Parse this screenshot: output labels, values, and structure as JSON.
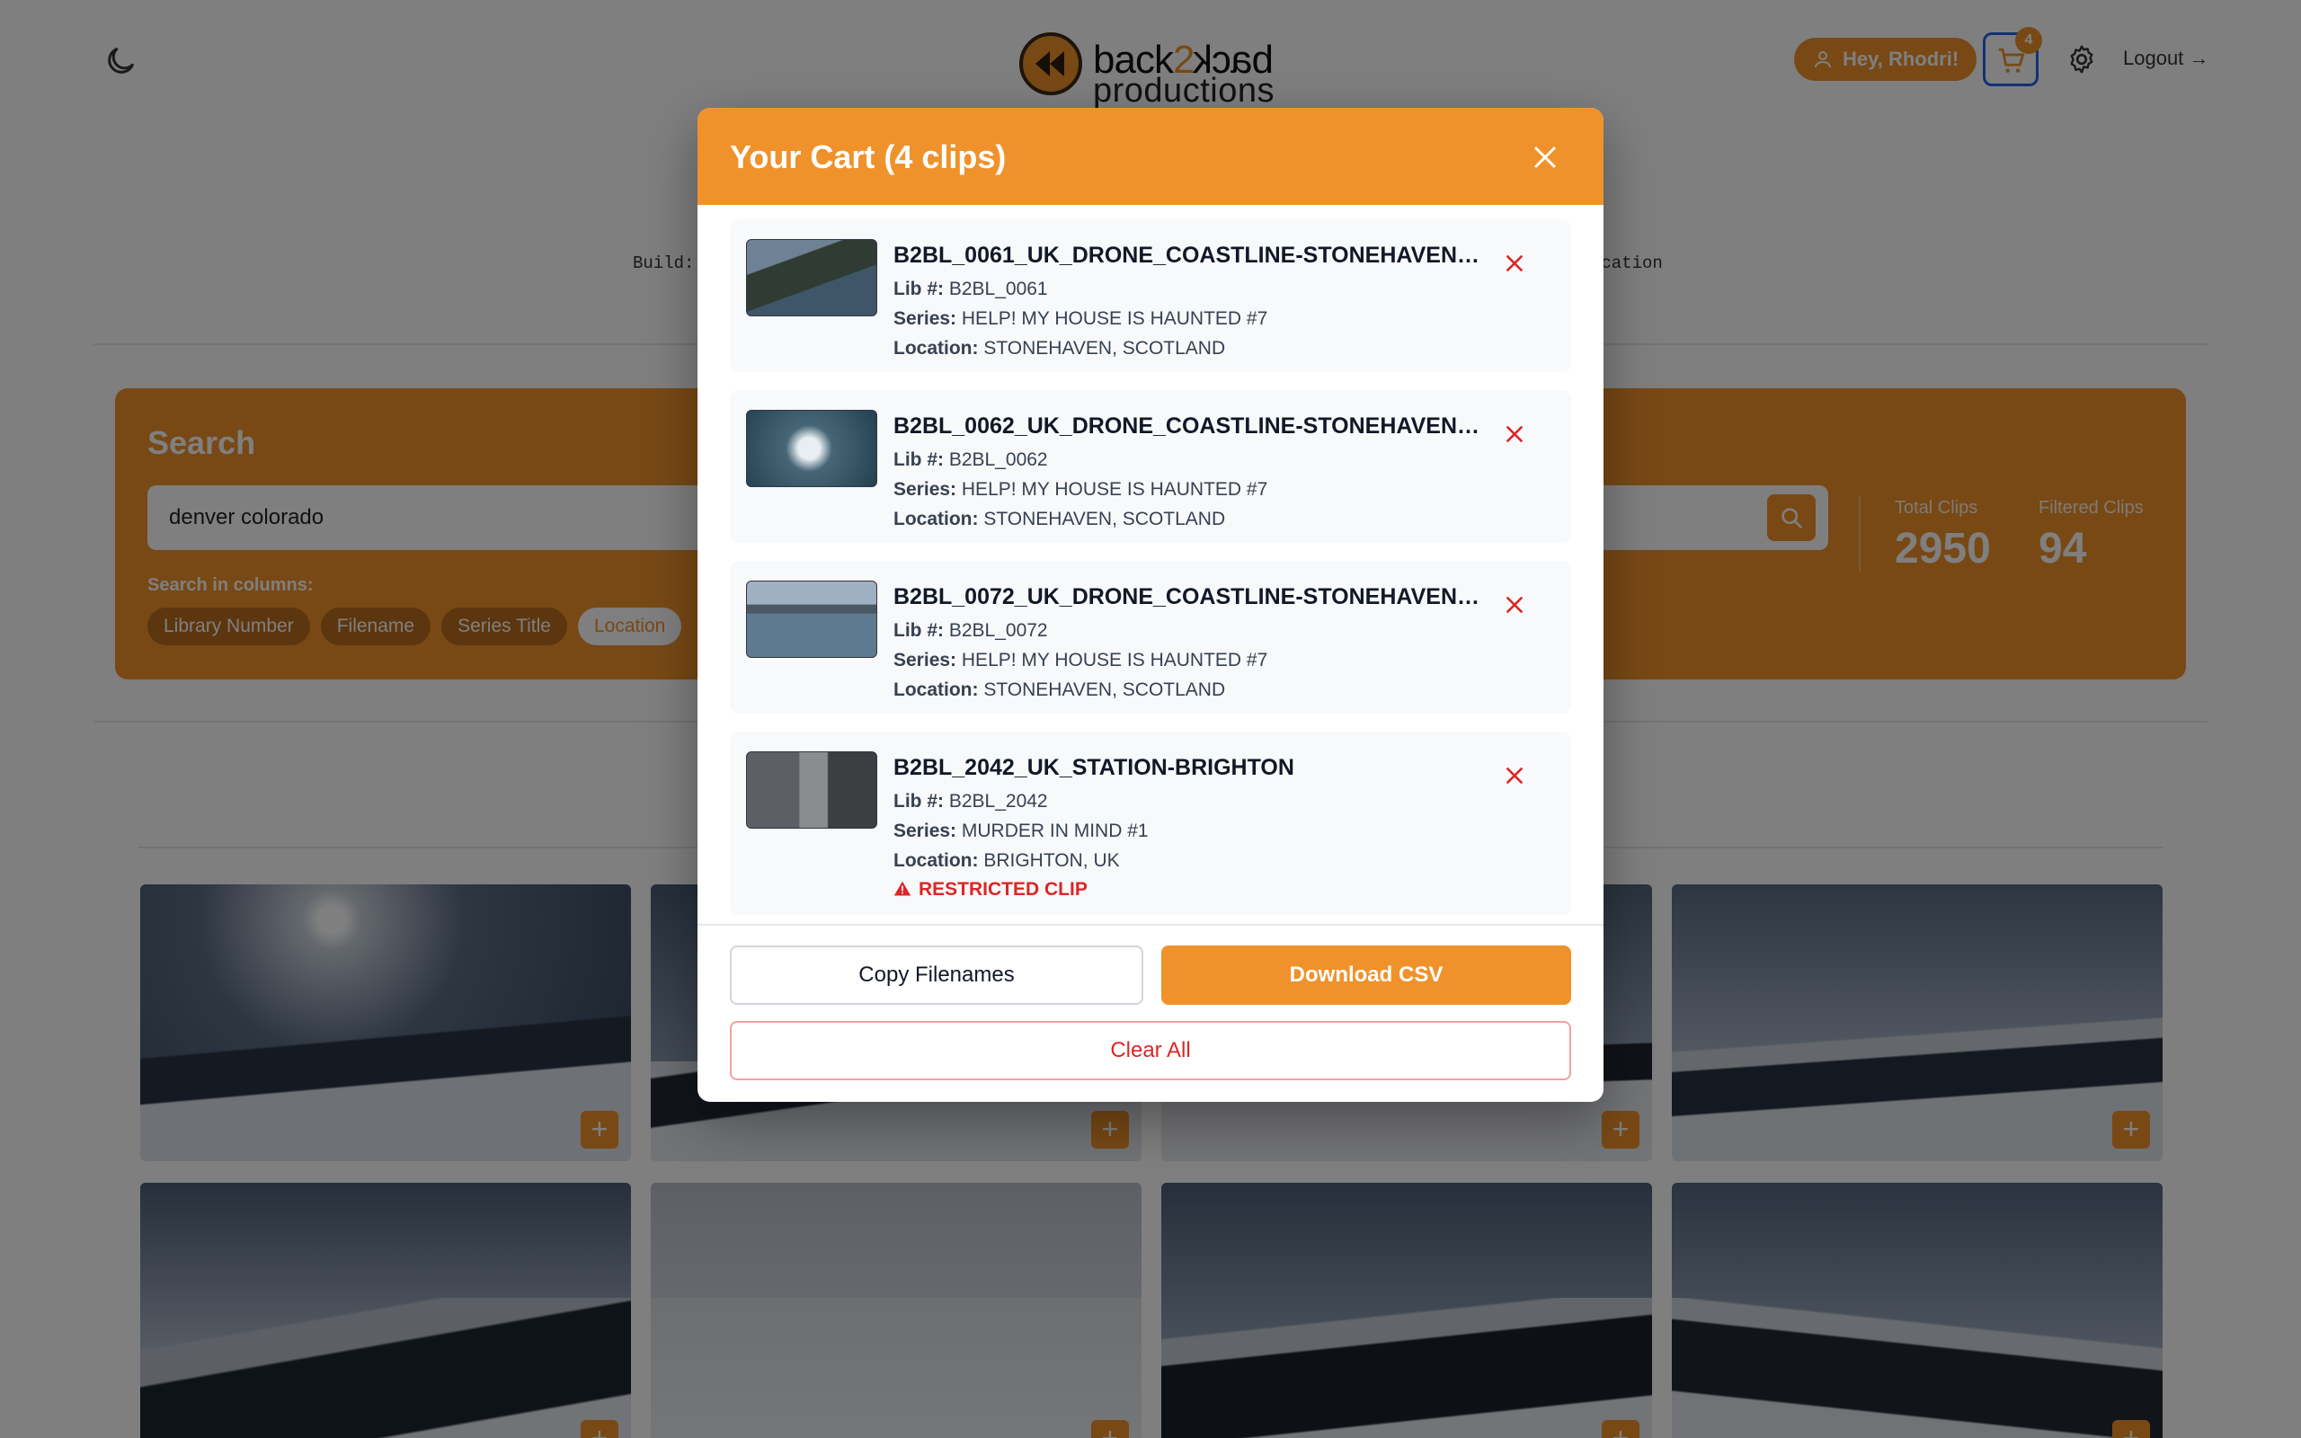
{
  "header": {
    "logo_word_left": "back",
    "logo_word_two": "2",
    "logo_word_right": "back",
    "logo_sub": "productions",
    "greeting": "Hey, Rhodri!",
    "cart_count": "4",
    "logout_label": "Logout →"
  },
  "build": {
    "left_text": "Build:",
    "right_text": "ocation"
  },
  "search": {
    "title": "Search",
    "query": "denver colorado",
    "columns_label": "Search in columns:",
    "chips": [
      "Library Number",
      "Filename",
      "Series Title",
      "Location"
    ],
    "active_chip": "Location",
    "total_label": "Total Clips",
    "total_value": "2950",
    "filtered_label": "Filtered Clips",
    "filtered_value": "94"
  },
  "cart": {
    "title": "Your Cart (4 clips)",
    "lib_label": "Lib #:",
    "series_label": "Series:",
    "location_label": "Location:",
    "items": [
      {
        "filename": "B2BL_0061_UK_DRONE_COASTLINE-STONEHAVEN_S...",
        "lib": "B2BL_0061",
        "series": "HELP! MY HOUSE IS HAUNTED #7",
        "location": "STONEHAVEN, SCOTLAND"
      },
      {
        "filename": "B2BL_0062_UK_DRONE_COASTLINE-STONEHAVEN_S...",
        "lib": "B2BL_0062",
        "series": "HELP! MY HOUSE IS HAUNTED #7",
        "location": "STONEHAVEN, SCOTLAND"
      },
      {
        "filename": "B2BL_0072_UK_DRONE_COASTLINE-STONEHAVEN_S...",
        "lib": "B2BL_0072",
        "series": "HELP! MY HOUSE IS HAUNTED #7",
        "location": "STONEHAVEN, SCOTLAND"
      },
      {
        "filename": "B2BL_2042_UK_STATION-BRIGHTON",
        "lib": "B2BL_2042",
        "series": "MURDER IN MIND #1",
        "location": "BRIGHTON, UK",
        "restricted": "RESTRICTED CLIP"
      }
    ],
    "copy_label": "Copy Filenames",
    "csv_label": "Download CSV",
    "clear_label": "Clear All"
  },
  "grid": {
    "add_label": "+"
  },
  "colors": {
    "accent": "#f0922b",
    "danger": "#dc2626",
    "focus": "#2563eb"
  }
}
